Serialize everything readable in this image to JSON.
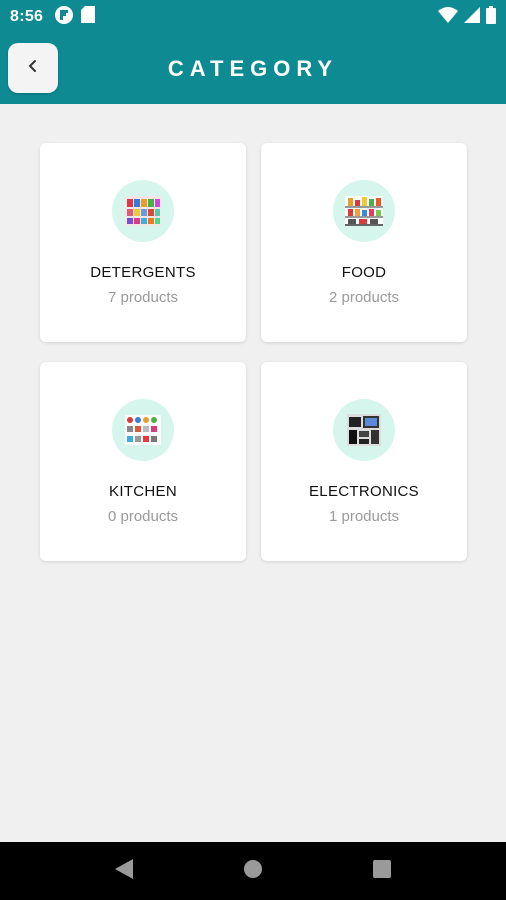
{
  "status_bar": {
    "time": "8:56",
    "left_icons": [
      "flipboard-icon",
      "sd-card-icon"
    ],
    "right_icons": [
      "wifi-icon",
      "cellular-signal-icon",
      "battery-icon"
    ]
  },
  "app_bar": {
    "title": "CATEGORY",
    "back_icon": "chevron-left-icon",
    "color": "#0e8a93"
  },
  "categories": [
    {
      "name": "DETERGENTS",
      "count": "7 products",
      "image": "detergents-thumbnail"
    },
    {
      "name": "FOOD",
      "count": "2 products",
      "image": "food-thumbnail"
    },
    {
      "name": "KITCHEN",
      "count": "0 products",
      "image": "kitchen-thumbnail"
    },
    {
      "name": "ELECTRONICS",
      "count": "1 products",
      "image": "electronics-thumbnail"
    }
  ],
  "nav_bar": {
    "buttons": [
      "back-triangle-icon",
      "home-circle-icon",
      "recents-square-icon"
    ]
  }
}
